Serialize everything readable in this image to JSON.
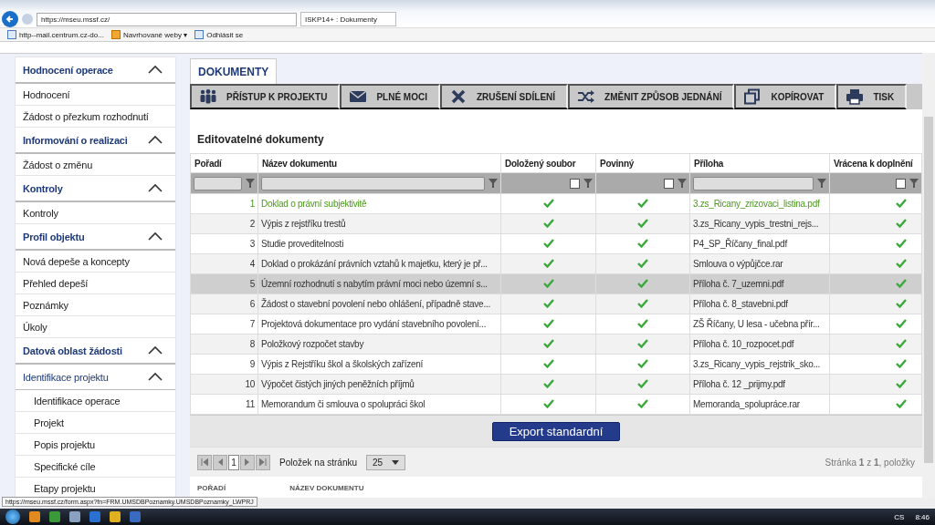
{
  "browser": {
    "address": "https://mseu.mssf.cz/",
    "tab": "ISKP14+ : Dokumenty",
    "favorites": [
      {
        "label": "http--mail.centrum.cz-do...",
        "kind": "page"
      },
      {
        "label": "Navrhované weby ▾",
        "kind": "folder"
      },
      {
        "label": "Odhlásit se",
        "kind": "page"
      }
    ]
  },
  "sidebar": [
    {
      "kind": "section",
      "label": "Hodnocení operace",
      "expanded": true
    },
    {
      "kind": "item",
      "label": "Hodnocení"
    },
    {
      "kind": "item",
      "label": "Žádost o přezkum rozhodnutí"
    },
    {
      "kind": "section",
      "label": "Informování o realizaci",
      "expanded": true
    },
    {
      "kind": "item",
      "label": "Žádost o změnu"
    },
    {
      "kind": "section",
      "label": "Kontroly",
      "expanded": true
    },
    {
      "kind": "item",
      "label": "Kontroly"
    },
    {
      "kind": "section",
      "label": "Profil objektu",
      "expanded": true
    },
    {
      "kind": "item",
      "label": "Nová depeše a koncepty"
    },
    {
      "kind": "item",
      "label": "Přehled depeší"
    },
    {
      "kind": "item",
      "label": "Poznámky"
    },
    {
      "kind": "item",
      "label": "Úkoly"
    },
    {
      "kind": "section",
      "label": "Datová oblast žádosti",
      "expanded": true
    },
    {
      "kind": "subsection",
      "label": "Identifikace projektu",
      "expanded": true
    },
    {
      "kind": "subitem",
      "label": "Identifikace operace"
    },
    {
      "kind": "subitem",
      "label": "Projekt"
    },
    {
      "kind": "subitem",
      "label": "Popis projektu"
    },
    {
      "kind": "subitem",
      "label": "Specifické cíle"
    },
    {
      "kind": "subitem",
      "label": "Etapy projektu"
    }
  ],
  "tabs": [
    {
      "label": "DOKUMENTY",
      "selected": true
    }
  ],
  "toolbar": [
    {
      "label": "PŘÍSTUP K PROJEKTU",
      "kind": "people"
    },
    {
      "label": "PLNÉ MOCI",
      "kind": "mail"
    },
    {
      "label": "ZRUŠENÍ SDÍLENÍ",
      "kind": "cross"
    },
    {
      "label": "ZMĚNIT ZPŮSOB JEDNÁNÍ",
      "kind": "shuffle"
    },
    {
      "label": "KOPÍROVAT",
      "kind": "copy"
    },
    {
      "label": "TISK",
      "kind": "print"
    }
  ],
  "section_title": "Editovatelné dokumenty",
  "table": {
    "columns": [
      "Pořadí",
      "Název dokumentu",
      "Doložený soubor",
      "Povinný",
      "Příloha",
      "Vrácena k doplnění"
    ],
    "filters": [
      {
        "kind": "text"
      },
      {
        "kind": "text"
      },
      {
        "kind": "check",
        "checked": false
      },
      {
        "kind": "check",
        "checked": false
      },
      {
        "kind": "text"
      },
      {
        "kind": "check",
        "checked": false
      }
    ],
    "rows": [
      {
        "order": "1",
        "name": "Doklad o právní subjektivitě",
        "documented": true,
        "mandatory": true,
        "attachment": "3.zs_Ricany_zrizovaci_listina.pdf",
        "returned": true,
        "selected": false,
        "highlighted": true
      },
      {
        "order": "2",
        "name": "Výpis z rejstříku trestů",
        "documented": true,
        "mandatory": true,
        "attachment": "3.zs_Ricany_vypis_trestni_rejs...",
        "returned": true,
        "selected": false,
        "highlighted": false
      },
      {
        "order": "3",
        "name": "Studie proveditelnosti",
        "documented": true,
        "mandatory": true,
        "attachment": "P4_SP_Říčany_final.pdf",
        "returned": true,
        "selected": false,
        "highlighted": false
      },
      {
        "order": "4",
        "name": "Doklad o prokázání právních vztahů k majetku, který je př...",
        "documented": true,
        "mandatory": true,
        "attachment": "Smlouva o výpůjčce.rar",
        "returned": true,
        "selected": false,
        "highlighted": false
      },
      {
        "order": "5",
        "name": "Územní rozhodnutí s nabytím právní moci nebo územní s...",
        "documented": true,
        "mandatory": true,
        "attachment": "Příloha č. 7_uzemni.pdf",
        "returned": true,
        "selected": true,
        "highlighted": false
      },
      {
        "order": "6",
        "name": "Žádost o stavební povolení nebo ohlášení, případně stave...",
        "documented": true,
        "mandatory": true,
        "attachment": "Příloha č. 8_stavebni.pdf",
        "returned": true,
        "selected": false,
        "highlighted": false
      },
      {
        "order": "7",
        "name": "Projektová dokumentace pro vydání stavebního povolení...",
        "documented": true,
        "mandatory": true,
        "attachment": "ZŠ Říčany, U lesa - učebna přír...",
        "returned": true,
        "selected": false,
        "highlighted": false
      },
      {
        "order": "8",
        "name": "Položkový rozpočet stavby",
        "documented": true,
        "mandatory": true,
        "attachment": "Příloha č. 10_rozpocet.pdf",
        "returned": true,
        "selected": false,
        "highlighted": false
      },
      {
        "order": "9",
        "name": "Výpis z Rejstříku škol a školských zařízení",
        "documented": true,
        "mandatory": true,
        "attachment": "3.zs_Ricany_vypis_rejstrik_sko...",
        "returned": true,
        "selected": false,
        "highlighted": false
      },
      {
        "order": "10",
        "name": "Výpočet čistých jiných peněžních příjmů",
        "documented": true,
        "mandatory": true,
        "attachment": "Příloha č. 12 _prijmy.pdf",
        "returned": true,
        "selected": false,
        "highlighted": false
      },
      {
        "order": "11",
        "name": "Memorandum či smlouva o spolupráci škol",
        "documented": true,
        "mandatory": true,
        "attachment": "Memoranda_spolupráce.rar",
        "returned": true,
        "selected": false,
        "highlighted": false
      }
    ]
  },
  "export_button": "Export standardní",
  "pager": {
    "page": "1",
    "page_size_label": "Položek na stránku",
    "page_size": "25",
    "summary": "Stránka **1** z **1**, položky"
  },
  "next_table_columns": [
    "POŘADÍ",
    "NÁZEV DOKUMENTU"
  ],
  "status_url": "https://mseu.mssf.cz/form.aspx?fn=FRM.UMSDBPoznamky.UMSDBPoznamky_LWPRJ",
  "taskbar": {
    "language": "CS",
    "time": "8:46"
  }
}
